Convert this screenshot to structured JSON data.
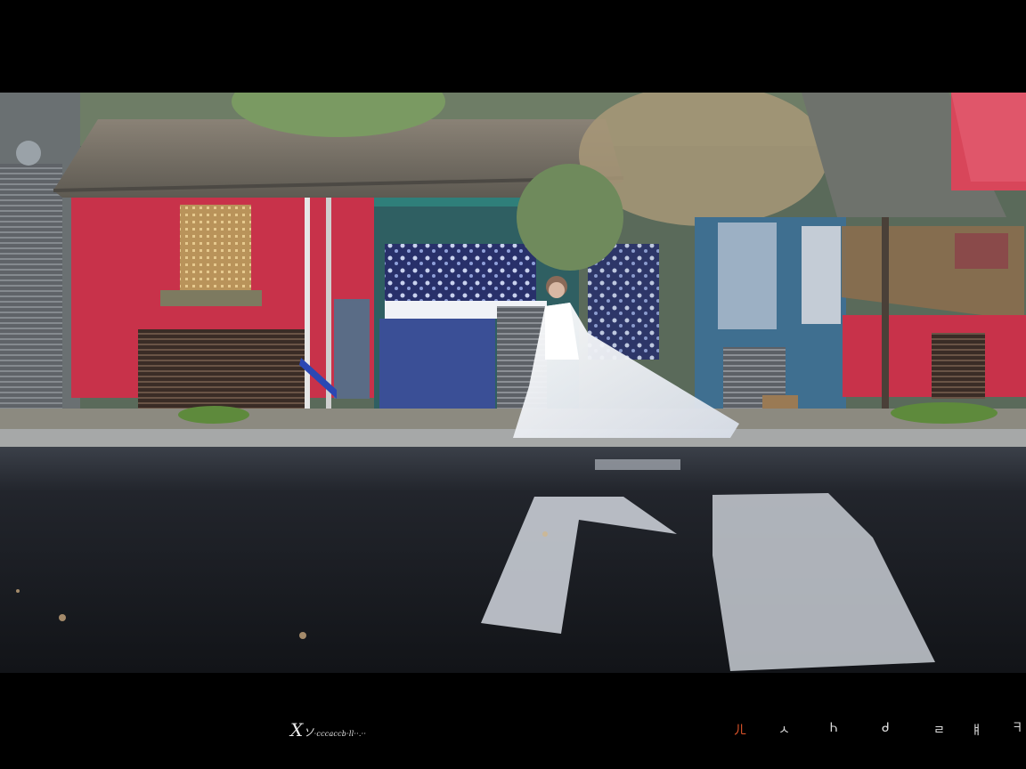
{
  "photo": {
    "alt": "",
    "colors": {
      "wall_red": "#c8324a",
      "roof": "#7a7468",
      "asphalt": "#1c1f26",
      "arrow": "#c8ccd4",
      "dress": "#f2f4f8",
      "shutter_blue": "#3a4f96",
      "teal_trim": "#2f7f7a"
    }
  },
  "caption": {
    "mark": "X",
    "text": "ソ",
    "small": "·cccaccb·ll··.··"
  },
  "glyphs": [
    "ㄦ",
    "ㅅ",
    "Ꮒ",
    "ᑯ",
    "ㄹ",
    "ㅒ",
    "ᖷ"
  ],
  "glyph_colors": [
    "#e0552a",
    "#dddddd",
    "#dddddd",
    "#dddddd",
    "#dddddd",
    "#dddddd",
    "#dddddd"
  ]
}
